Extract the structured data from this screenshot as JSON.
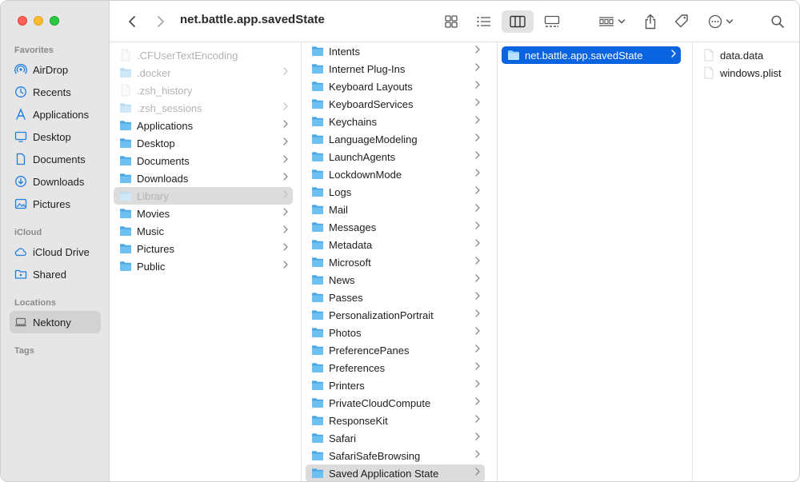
{
  "toolbar": {
    "title": "net.battle.app.savedState"
  },
  "sidebar": {
    "favorites_label": "Favorites",
    "favorites": [
      {
        "label": "AirDrop",
        "icon": "airdrop-icon"
      },
      {
        "label": "Recents",
        "icon": "clock-icon"
      },
      {
        "label": "Applications",
        "icon": "applications-icon"
      },
      {
        "label": "Desktop",
        "icon": "desktop-icon"
      },
      {
        "label": "Documents",
        "icon": "document-icon"
      },
      {
        "label": "Downloads",
        "icon": "download-icon"
      },
      {
        "label": "Pictures",
        "icon": "photo-icon"
      }
    ],
    "icloud_label": "iCloud",
    "icloud": [
      {
        "label": "iCloud Drive",
        "icon": "cloud-icon"
      },
      {
        "label": "Shared",
        "icon": "shared-folder-icon"
      }
    ],
    "locations_label": "Locations",
    "locations": [
      {
        "label": "Nektony",
        "icon": "laptop-icon"
      }
    ],
    "tags_label": "Tags"
  },
  "columns": {
    "home": [
      {
        "label": ".CFUserTextEncoding",
        "kind": "file",
        "dim": true,
        "chevron": false
      },
      {
        "label": ".docker",
        "kind": "folder",
        "dim": true,
        "chevron": true
      },
      {
        "label": ".zsh_history",
        "kind": "file",
        "dim": true,
        "chevron": false
      },
      {
        "label": ".zsh_sessions",
        "kind": "folder",
        "dim": true,
        "chevron": true
      },
      {
        "label": "Applications",
        "kind": "folder",
        "dim": false,
        "chevron": true
      },
      {
        "label": "Desktop",
        "kind": "folder",
        "dim": false,
        "chevron": true
      },
      {
        "label": "Documents",
        "kind": "folder",
        "dim": false,
        "chevron": true
      },
      {
        "label": "Downloads",
        "kind": "folder",
        "dim": false,
        "chevron": true
      },
      {
        "label": "Library",
        "kind": "folder",
        "dim": true,
        "chevron": true,
        "selected": "gray"
      },
      {
        "label": "Movies",
        "kind": "folder",
        "dim": false,
        "chevron": true
      },
      {
        "label": "Music",
        "kind": "folder",
        "dim": false,
        "chevron": true
      },
      {
        "label": "Pictures",
        "kind": "folder",
        "dim": false,
        "chevron": true
      },
      {
        "label": "Public",
        "kind": "folder",
        "dim": false,
        "chevron": true
      }
    ],
    "library": [
      {
        "label": "Intents"
      },
      {
        "label": "Internet Plug-Ins"
      },
      {
        "label": "Keyboard Layouts"
      },
      {
        "label": "KeyboardServices"
      },
      {
        "label": "Keychains"
      },
      {
        "label": "LanguageModeling"
      },
      {
        "label": "LaunchAgents"
      },
      {
        "label": "LockdownMode"
      },
      {
        "label": "Logs"
      },
      {
        "label": "Mail"
      },
      {
        "label": "Messages"
      },
      {
        "label": "Metadata"
      },
      {
        "label": "Microsoft"
      },
      {
        "label": "News"
      },
      {
        "label": "Passes"
      },
      {
        "label": "PersonalizationPortrait"
      },
      {
        "label": "Photos"
      },
      {
        "label": "PreferencePanes"
      },
      {
        "label": "Preferences"
      },
      {
        "label": "Printers"
      },
      {
        "label": "PrivateCloudCompute"
      },
      {
        "label": "ResponseKit"
      },
      {
        "label": "Safari"
      },
      {
        "label": "SafariSafeBrowsing"
      },
      {
        "label": "Saved Application State",
        "selected": "gray"
      }
    ],
    "saved_state": [
      {
        "label": "net.battle.app.savedState",
        "selected": "blue"
      }
    ],
    "contents": [
      {
        "label": "data.data"
      },
      {
        "label": "windows.plist"
      }
    ]
  },
  "colors": {
    "folder": "#5ab4ec",
    "selection_blue": "#0a64e0",
    "selection_gray": "#dcdcdc"
  }
}
